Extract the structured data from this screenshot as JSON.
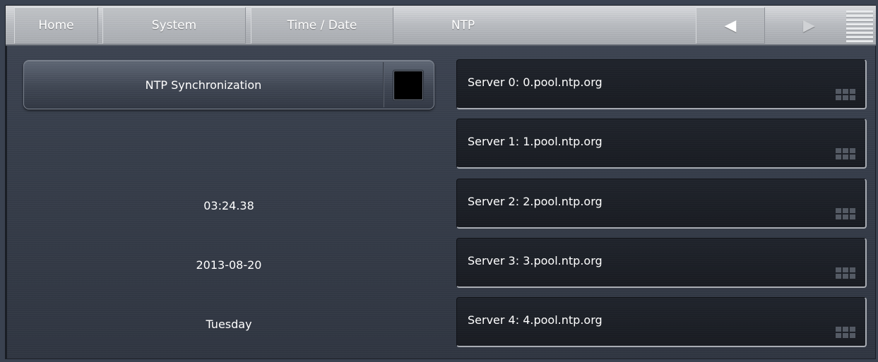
{
  "header": {
    "tabs": [
      {
        "label": "Home"
      },
      {
        "label": "System"
      },
      {
        "label": "Time / Date"
      },
      {
        "label": "NTP"
      }
    ],
    "nav_prev_glyph": "◀",
    "nav_next_glyph": "▶",
    "menu_icon": "hamburger-menu-icon"
  },
  "left_panel": {
    "ntp_sync_label": "NTP Synchronization",
    "ntp_sync_enabled": false,
    "time": "03:24.38",
    "date": "2013-08-20",
    "weekday": "Tuesday"
  },
  "servers": [
    {
      "label": "Server 0: 0.pool.ntp.org"
    },
    {
      "label": "Server 1: 1.pool.ntp.org"
    },
    {
      "label": "Server 2: 2.pool.ntp.org"
    },
    {
      "label": "Server 3: 3.pool.ntp.org"
    },
    {
      "label": "Server 4: 4.pool.ntp.org"
    }
  ],
  "colors": {
    "background": "#3a4250",
    "header": "#b8bbc0",
    "server_field": "#1c1f26",
    "checkbox": "#000000"
  }
}
